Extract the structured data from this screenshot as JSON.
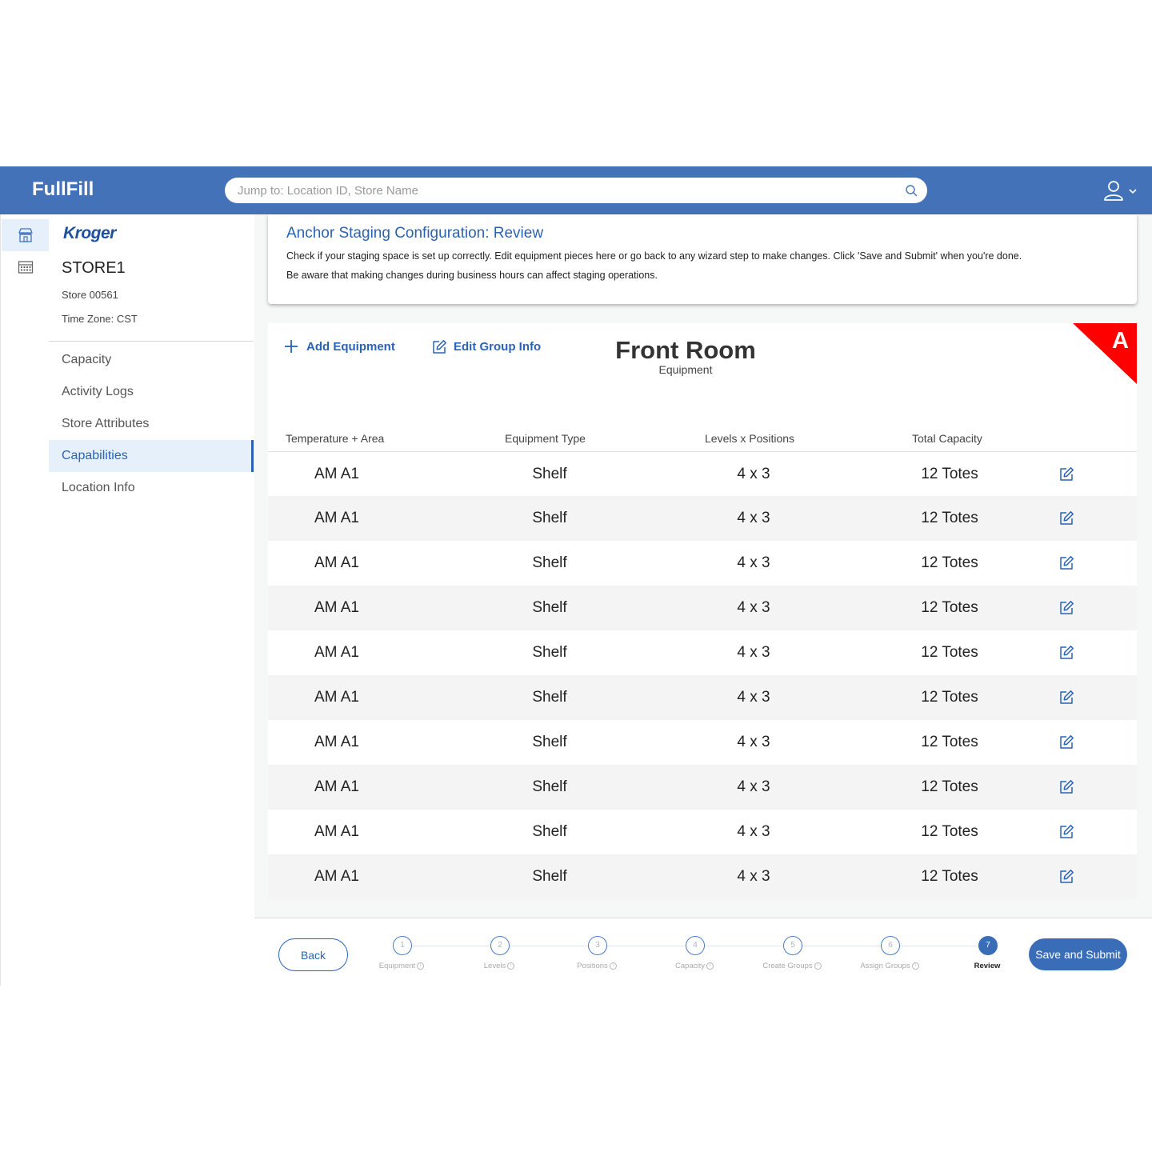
{
  "app": {
    "brand": "FullFill",
    "search_placeholder": "Jump to: Location ID, Store Name",
    "accent": "#4472b8"
  },
  "sidebar": {
    "logo": "Kroger",
    "store_name": "STORE1",
    "store_number": "Store 00561",
    "time_zone": "Time Zone: CST",
    "items": [
      {
        "label": "Capacity",
        "active": false
      },
      {
        "label": "Activity Logs",
        "active": false
      },
      {
        "label": "Store Attributes",
        "active": false
      },
      {
        "label": "Capabilities",
        "active": true
      },
      {
        "label": "Location Info",
        "active": false
      }
    ]
  },
  "review": {
    "title": "Anchor Staging Configuration: Review",
    "line1": "Check if your staging space is set up correctly. Edit equipment pieces here or go back to any wizard step to make changes. Click 'Save and Submit' when you're done.",
    "line2": "Be aware that making changes during business hours can affect staging operations."
  },
  "equipment": {
    "add_label": "Add Equipment",
    "edit_group_label": "Edit Group Info",
    "room": "Front Room",
    "room_sub": "Equipment",
    "group_letter": "A",
    "group_color": "#ff0000",
    "columns": [
      "Temperature + Area",
      "Equipment Type",
      "Levels x Positions",
      "Total Capacity"
    ],
    "rows": [
      {
        "area": "AM A1",
        "type": "Shelf",
        "levels": "4 x 3",
        "capacity": "12 Totes"
      },
      {
        "area": "AM A1",
        "type": "Shelf",
        "levels": "4 x 3",
        "capacity": "12 Totes"
      },
      {
        "area": "AM A1",
        "type": "Shelf",
        "levels": "4 x 3",
        "capacity": "12 Totes"
      },
      {
        "area": "AM A1",
        "type": "Shelf",
        "levels": "4 x 3",
        "capacity": "12 Totes"
      },
      {
        "area": "AM A1",
        "type": "Shelf",
        "levels": "4 x 3",
        "capacity": "12 Totes"
      },
      {
        "area": "AM A1",
        "type": "Shelf",
        "levels": "4 x 3",
        "capacity": "12 Totes"
      },
      {
        "area": "AM A1",
        "type": "Shelf",
        "levels": "4 x 3",
        "capacity": "12 Totes"
      },
      {
        "area": "AM A1",
        "type": "Shelf",
        "levels": "4 x 3",
        "capacity": "12 Totes"
      },
      {
        "area": "AM A1",
        "type": "Shelf",
        "levels": "4 x 3",
        "capacity": "12 Totes"
      },
      {
        "area": "AM A1",
        "type": "Shelf",
        "levels": "4 x 3",
        "capacity": "12 Totes"
      }
    ]
  },
  "wizard": {
    "back_label": "Back",
    "submit_label": "Save and Submit",
    "steps": [
      {
        "num": "1",
        "label": "Equipment",
        "info": true,
        "active": false
      },
      {
        "num": "2",
        "label": "Levels",
        "info": true,
        "active": false
      },
      {
        "num": "3",
        "label": "Positions",
        "info": true,
        "active": false
      },
      {
        "num": "4",
        "label": "Capacity",
        "info": true,
        "active": false
      },
      {
        "num": "5",
        "label": "Create Groups",
        "info": true,
        "active": false
      },
      {
        "num": "6",
        "label": "Assign Groups",
        "info": true,
        "active": false
      },
      {
        "num": "7",
        "label": "Review",
        "info": false,
        "active": true
      }
    ]
  }
}
